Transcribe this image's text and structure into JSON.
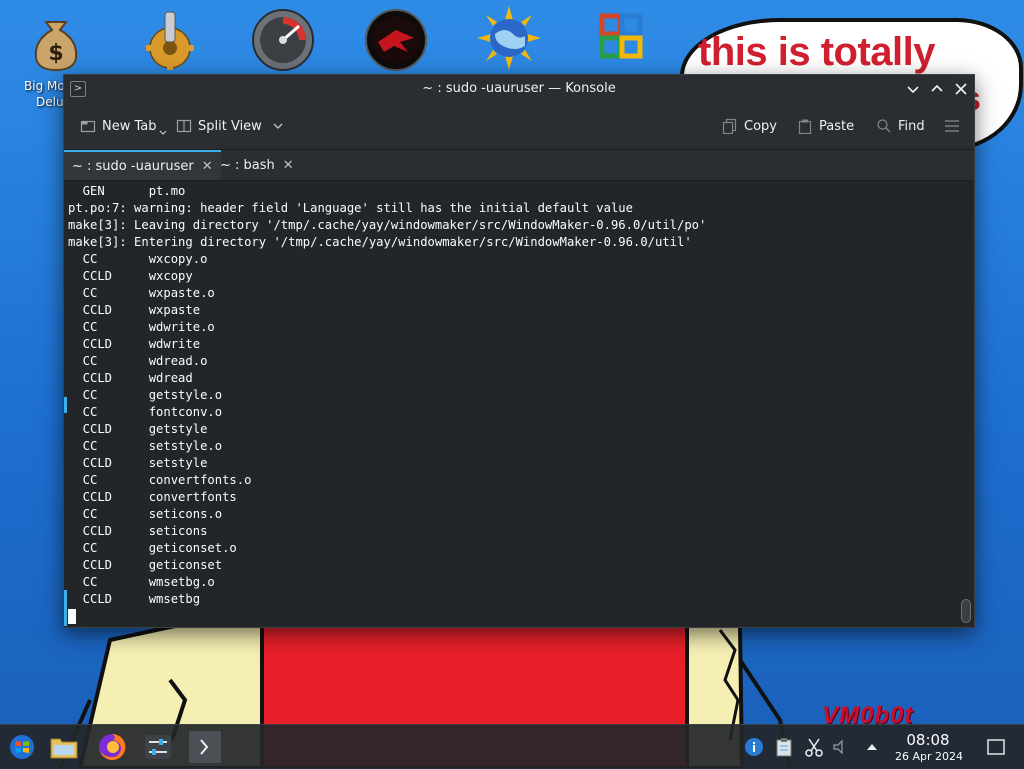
{
  "desktop": {
    "icon_label_line1": "Big Mo",
    "icon_label_line2": "Delu",
    "bubble_text": "this is totally",
    "bubble_trail": "s",
    "watermark": "VM0b0t"
  },
  "window": {
    "app_icon": ">",
    "title": "~ : sudo -uauruser — Konsole"
  },
  "toolbar": {
    "new_tab": "New Tab",
    "split_view": "Split View",
    "copy": "Copy",
    "paste": "Paste",
    "find": "Find"
  },
  "tabs": [
    {
      "label": "~ : sudo -uauruser",
      "close": "✕"
    },
    {
      "label": "~ : bash",
      "close": "✕"
    }
  ],
  "terminal": {
    "lines": [
      "  GEN      pt.mo",
      "pt.po:7: warning: header field 'Language' still has the initial default value",
      "make[3]: Leaving directory '/tmp/.cache/yay/windowmaker/src/WindowMaker-0.96.0/util/po'",
      "make[3]: Entering directory '/tmp/.cache/yay/windowmaker/src/WindowMaker-0.96.0/util'",
      "  CC       wxcopy.o",
      "  CCLD     wxcopy",
      "  CC       wxpaste.o",
      "  CCLD     wxpaste",
      "  CC       wdwrite.o",
      "  CCLD     wdwrite",
      "  CC       wdread.o",
      "  CCLD     wdread",
      "  CC       getstyle.o",
      "  CC       fontconv.o",
      "  CCLD     getstyle",
      "  CC       setstyle.o",
      "  CCLD     setstyle",
      "  CC       convertfonts.o",
      "  CCLD     convertfonts",
      "  CC       seticons.o",
      "  CCLD     seticons",
      "  CC       geticonset.o",
      "  CCLD     geticonset",
      "  CC       wmsetbg.o",
      "  CCLD     wmsetbg"
    ]
  },
  "taskbar": {
    "time": "08:08",
    "date": "26 Apr 2024"
  },
  "colors": {
    "accent": "#3daee9",
    "terminal_bg": "#232629",
    "terminal_fg": "#fcfcfc",
    "bubble_text": "#d01f2e"
  }
}
